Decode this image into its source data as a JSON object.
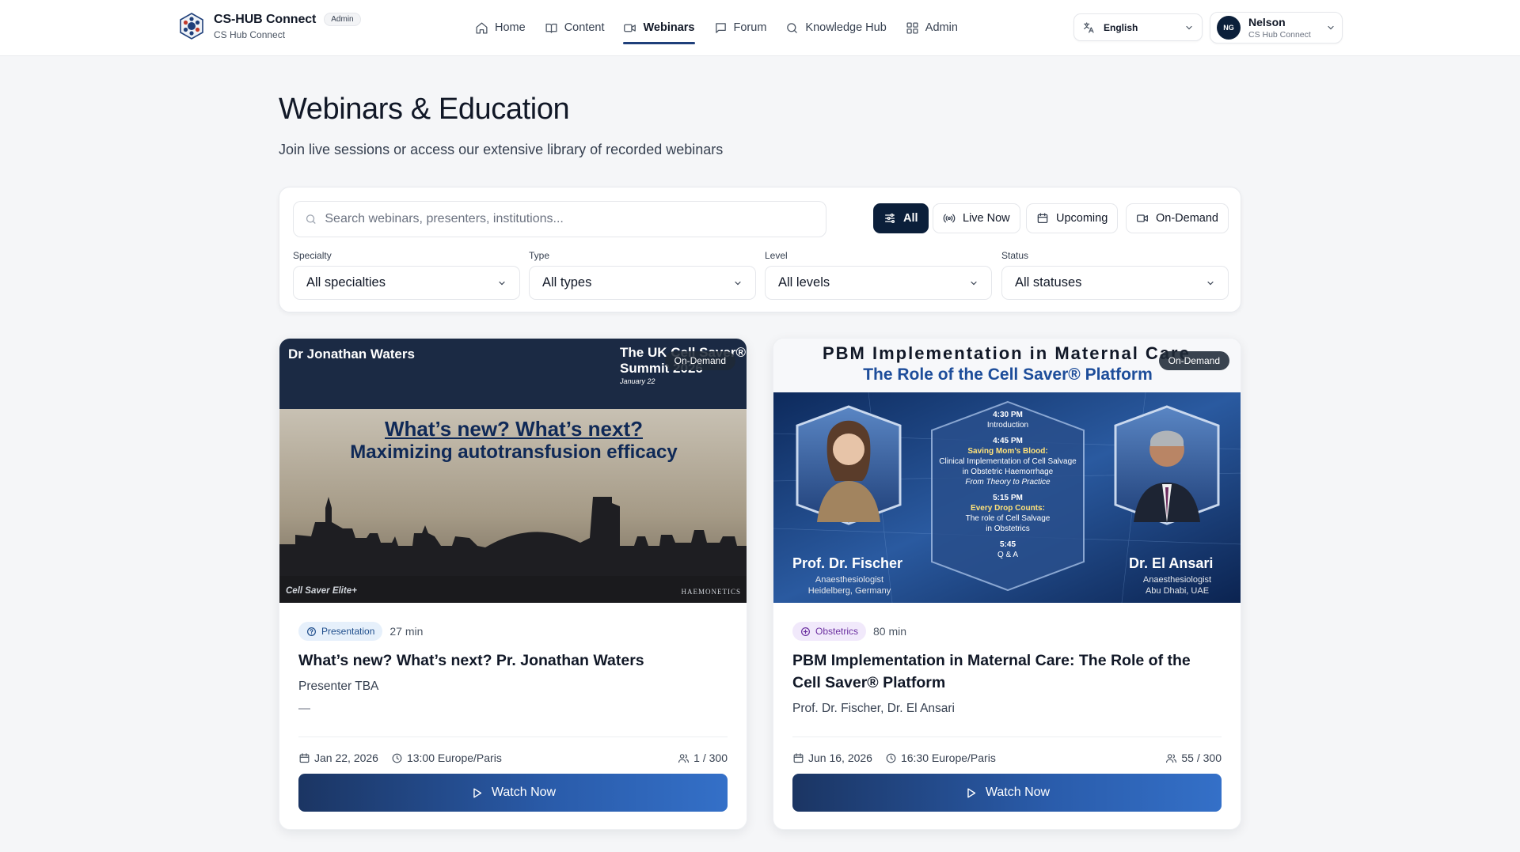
{
  "brand": {
    "name": "CS-HUB Connect",
    "badge": "Admin",
    "sub": "CS Hub Connect"
  },
  "nav": [
    {
      "label": "Home",
      "icon": "home-icon"
    },
    {
      "label": "Content",
      "icon": "book-icon"
    },
    {
      "label": "Webinars",
      "icon": "video-icon",
      "active": true
    },
    {
      "label": "Forum",
      "icon": "chat-icon"
    },
    {
      "label": "Knowledge Hub",
      "icon": "search-icon"
    },
    {
      "label": "Admin",
      "icon": "grid-icon"
    }
  ],
  "language": {
    "label": "English"
  },
  "user": {
    "initials": "NG",
    "name": "Nelson",
    "sub": "CS Hub Connect"
  },
  "page": {
    "title": "Webinars & Education",
    "subtitle": "Join live sessions or access our extensive library of recorded webinars"
  },
  "search": {
    "placeholder": "Search webinars, presenters, institutions..."
  },
  "segments": [
    {
      "label": "All",
      "icon": "sliders-icon",
      "active": true
    },
    {
      "label": "Live Now",
      "icon": "broadcast-icon"
    },
    {
      "label": "Upcoming",
      "icon": "calendar-icon"
    },
    {
      "label": "On-Demand",
      "icon": "video-icon"
    }
  ],
  "filters": [
    {
      "label": "Specialty",
      "value": "All specialties"
    },
    {
      "label": "Type",
      "value": "All types"
    },
    {
      "label": "Level",
      "value": "All levels"
    },
    {
      "label": "Status",
      "value": "All statuses"
    }
  ],
  "cards": [
    {
      "badge": "On-Demand",
      "thumb": {
        "name": "Dr Jonathan Waters",
        "summit": "The UK Cell Saver® Summit 2026",
        "summit_line1": "The UK Cell Saver®",
        "summit_line2": "Summit 2026",
        "date": "January 22",
        "headline1": "What’s new?  What’s next?",
        "headline2": "Maximizing autotransfusion efficacy",
        "brand_left": "Cell Saver Elite+",
        "brand_right": "HAEMONETICS"
      },
      "category": "Presentation",
      "duration": "27 min",
      "title": "What’s new? What’s next? Pr. Jonathan Waters",
      "presenter": "Presenter TBA",
      "institution": "—",
      "date": "Jan 22, 2026",
      "time": "13:00 Europe/Paris",
      "seats": "1 / 300",
      "button": "Watch Now"
    },
    {
      "badge": "On-Demand",
      "thumb": {
        "line1": "PBM Implementation in Maternal Care",
        "line2": "The Role of the Cell Saver® Platform",
        "t1": "4:30 PM",
        "d1": "Introduction",
        "t2": "4:45 PM",
        "d2a": "Saving Mom’s Blood:",
        "d2b": "Clinical Implementation of Cell Salvage",
        "d2c": "in Obstetric Haemorrhage",
        "d2d": "From Theory to Practice",
        "t3": "5:15 PM",
        "d3a": "Every Drop Counts:",
        "d3b": "The role of Cell Salvage",
        "d3c": "in Obstetrics",
        "t4": "5:45",
        "d4": "Q & A",
        "p1": "Prof. Dr. Fischer",
        "p1role": "Anaesthesiologist",
        "p1loc": "Heidelberg, Germany",
        "p2": "Dr. El Ansari",
        "p2role": "Anaesthesiologist",
        "p2loc": "Abu Dhabi, UAE"
      },
      "category": "Obstetrics",
      "duration": "80 min",
      "title": "PBM Implementation in Maternal Care: The Role of the Cell Saver® Platform",
      "presenter": "Prof. Dr. Fischer, Dr. El Ansari",
      "date": "Jun 16, 2026",
      "time": "16:30 Europe/Paris",
      "seats": "55 / 300",
      "button": "Watch Now"
    }
  ],
  "colors": {
    "brand_navy": "#0b1f3a",
    "accent_blue": "#2a5cab",
    "page_bg": "#f5f6f8"
  }
}
